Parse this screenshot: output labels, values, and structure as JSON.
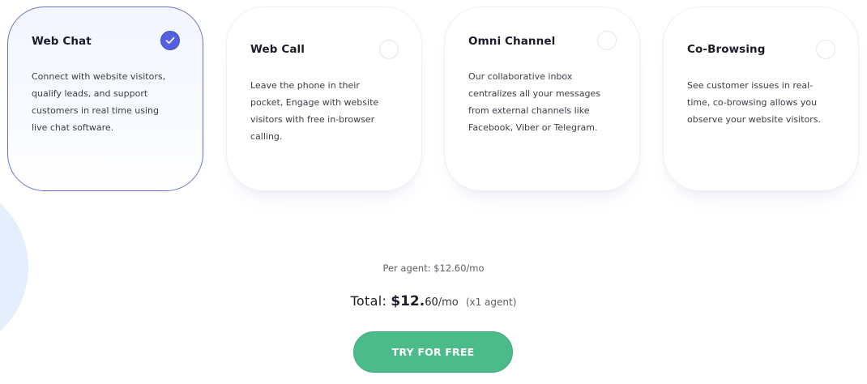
{
  "colors": {
    "accent": "#5560e0",
    "card_selected_border": "#6673cf",
    "cta": "#4bbb8a",
    "text_primary": "#1b1b2a",
    "text_secondary": "#3a3d4a"
  },
  "cards": [
    {
      "title": "Web Chat",
      "description": "Connect with website visitors, qualify leads, and support customers in real time using live chat software.",
      "selected": true,
      "icon": "checkmark-icon"
    },
    {
      "title": "Web Call",
      "description": "Leave the phone in their pocket, Engage with website visitors with free in-browser calling.",
      "selected": false
    },
    {
      "title": "Omni Channel",
      "description": "Our collaborative inbox centralizes all your messages from external channels like Facebook, Viber or Telegram.",
      "selected": false
    },
    {
      "title": "Co-Browsing",
      "description": "See customer issues in real-time, co-browsing allows you observe your website visitors.",
      "selected": false
    }
  ],
  "pricing": {
    "per_agent_text": "Per agent: $12.60/mo",
    "total_label": "Total:",
    "total_integer": "$12.",
    "total_decimal": "60",
    "total_period": "/mo",
    "total_agents": "(x1 agent)"
  },
  "cta": {
    "label": "TRY FOR FREE"
  }
}
